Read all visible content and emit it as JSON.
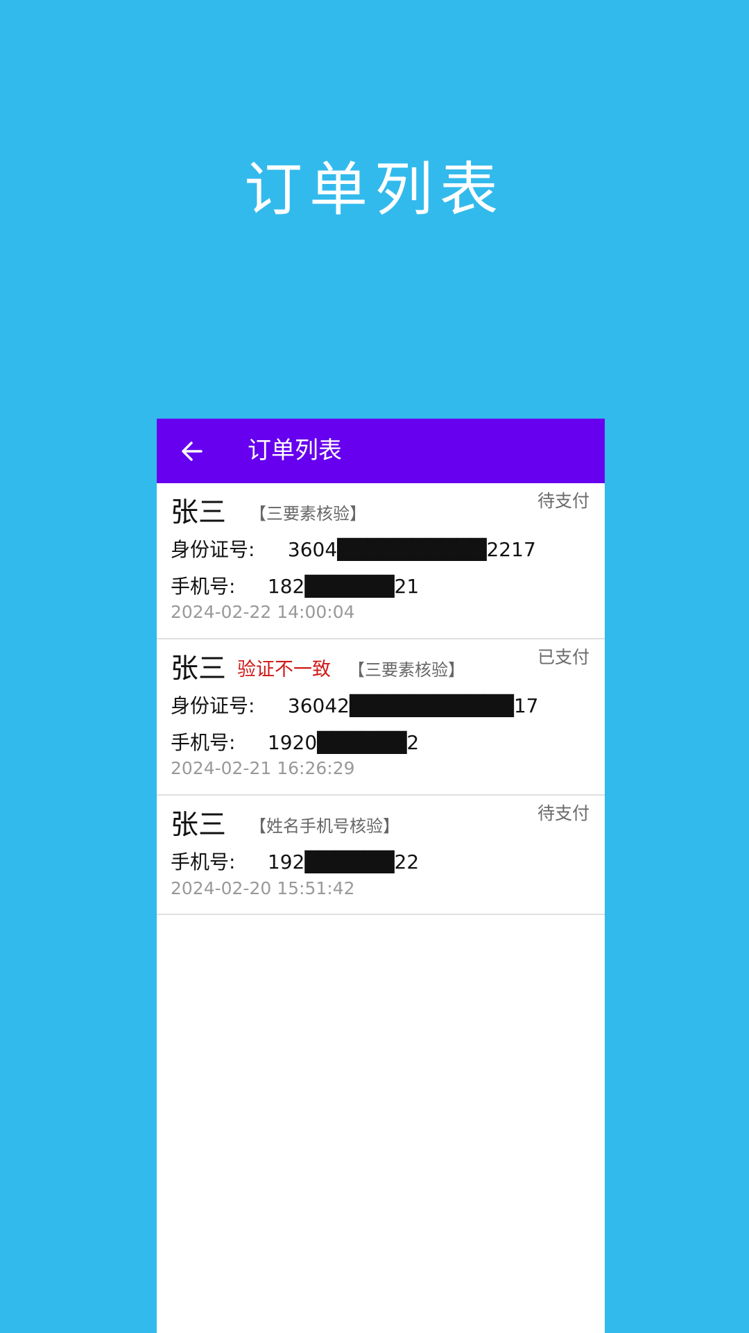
{
  "promo": {
    "title": "订单列表"
  },
  "appbar": {
    "back_icon": "arrow-left-icon",
    "title": "订单列表"
  },
  "orders": [
    {
      "name": "张三",
      "tag": "【三要素核验】",
      "status": "待支付",
      "id_label": "身份证号:",
      "id_value": "3604██████████2217",
      "phone_label": "手机号:",
      "phone_value": "182██████21",
      "time": "2024-02-22 14:00:04"
    },
    {
      "name": "张三",
      "warning": "验证不一致",
      "tag": "【三要素核验】",
      "status": "已支付",
      "id_label": "身份证号:",
      "id_value": "36042███████████17",
      "phone_label": "手机号:",
      "phone_value": "1920██████2",
      "time": "2024-02-21 16:26:29"
    },
    {
      "name": "张三",
      "tag": "【姓名手机号核验】",
      "status": "待支付",
      "phone_label": "手机号:",
      "phone_value": "192██████22",
      "time": "2024-02-20 15:51:42"
    }
  ],
  "colors": {
    "background": "#33baec",
    "appbar": "#6600ee",
    "warning": "#d01818",
    "muted": "#999999"
  }
}
